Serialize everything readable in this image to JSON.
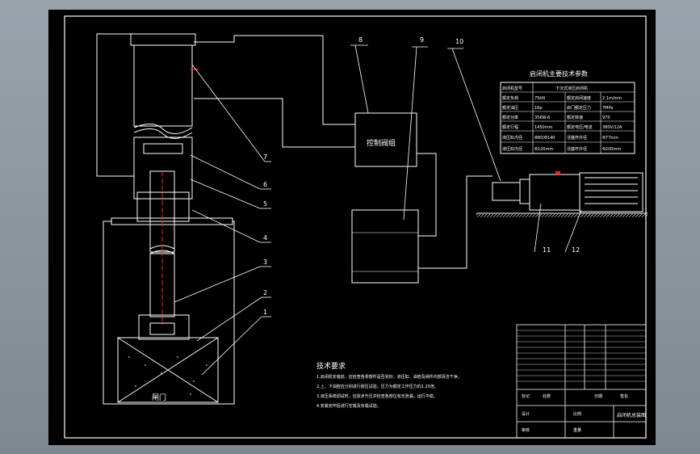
{
  "labels": {
    "gate_text": "闸门",
    "control_valve_group": "控制阀组",
    "tech_table_title": "启闭机主要技术参数",
    "tech_req_title": "技术要求",
    "title_block_name": "启闭机总装图"
  },
  "part_numbers": [
    "1",
    "2",
    "3",
    "4",
    "5",
    "6",
    "7",
    "8",
    "9",
    "10",
    "11",
    "12"
  ],
  "tech_table": {
    "header_left": "启闭机型号",
    "header_right": "下沉式液压启闭机",
    "rows": [
      [
        "额定负荷",
        "75kN",
        "额定启闭速度",
        "2.1m/min"
      ],
      [
        "额定油压",
        "16p",
        "启门额定压力",
        "7MPa"
      ],
      [
        "额定功率",
        "35KW-6",
        "额定转速",
        "970"
      ],
      [
        "额定行程",
        "1450mm",
        "额定电压/电流",
        "380V/12A"
      ],
      [
        "液压缸内径",
        "Φ80/Φ140",
        "活塞杆外径",
        "Φ77mm"
      ],
      [
        "液压缸内径",
        "Φ120mm",
        "活塞杆外径",
        "Φ200mm"
      ]
    ]
  },
  "tech_requirements": [
    "1.启闭机安装前，应检查各零部件是否完好，液压缸、油管及阀件内部清洁干净。",
    "2.上、下油腔应分别进行耐压试验，压力为额定工作压力的1.25倍。",
    "3.液压系统调试时，应逐步升压并检查各部位有无泄漏，运行平稳。",
    "4.安装完毕后进行空载及负载试验。"
  ],
  "title_block": {
    "row_labels": [
      "",
      "",
      "",
      "",
      "",
      "",
      "",
      "",
      "",
      "",
      "",
      ""
    ],
    "bottom_labels": [
      "设计",
      "审核",
      "比例",
      "重量",
      "共张"
    ],
    "marks": [
      "标记",
      "处数",
      "日期",
      "签名"
    ]
  },
  "colors": {
    "background": "#000000",
    "line": "#ffffff",
    "hydraulic_line": "#ffffff",
    "rod_centerline": "#ff2020",
    "viewport": "#8d959e"
  }
}
